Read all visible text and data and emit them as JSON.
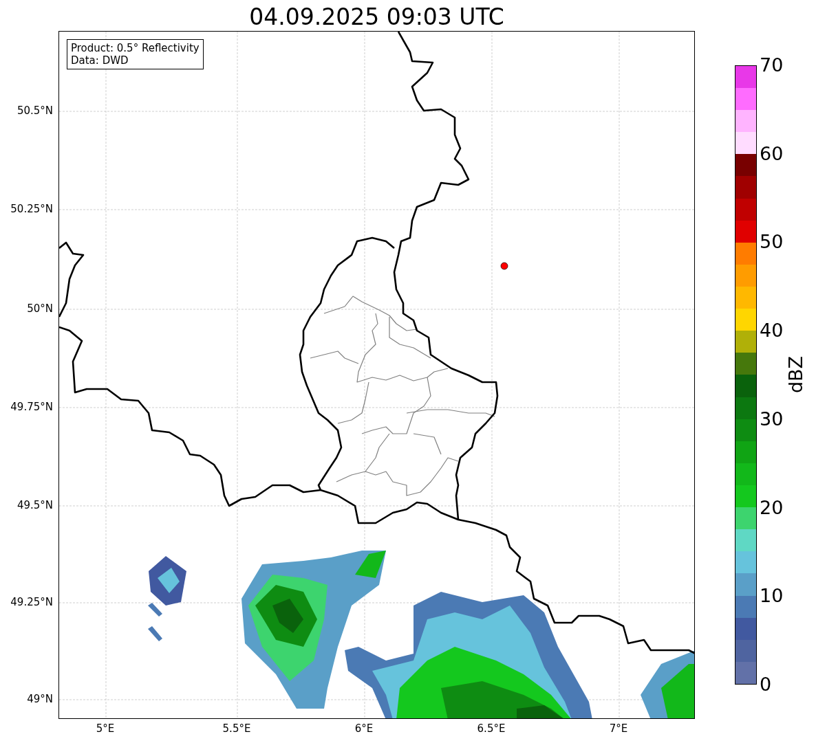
{
  "title": "04.09.2025 09:03 UTC",
  "annotation": [
    "Product: 0.5° Reflectivity",
    "Data: DWD"
  ],
  "y_ticks": [
    "50.5°N",
    "50.25°N",
    "50°N",
    "49.75°N",
    "49.5°N",
    "49.25°N",
    "49°N"
  ],
  "x_ticks": [
    "5°E",
    "5.5°E",
    "6°E",
    "6.5°E",
    "7°E"
  ],
  "colorbar": {
    "label": "dBZ",
    "ticks": [
      "70",
      "60",
      "50",
      "40",
      "30",
      "20",
      "10",
      "0"
    ],
    "bands": [
      {
        "color": "#6271a8"
      },
      {
        "color": "#4f64a0"
      },
      {
        "color": "#4159a0"
      },
      {
        "color": "#4b7ab4"
      },
      {
        "color": "#5a9fc8"
      },
      {
        "color": "#66c3dc"
      },
      {
        "color": "#5fd8c4"
      },
      {
        "color": "#3dd46e"
      },
      {
        "color": "#14c81e"
      },
      {
        "color": "#12b81a"
      },
      {
        "color": "#10a414"
      },
      {
        "color": "#0e8c12"
      },
      {
        "color": "#0c7810"
      },
      {
        "color": "#0a620c"
      },
      {
        "color": "#46780c"
      },
      {
        "color": "#b0b008"
      },
      {
        "color": "#ffd600"
      },
      {
        "color": "#ffb800"
      },
      {
        "color": "#ff9c00"
      },
      {
        "color": "#ff7c00"
      },
      {
        "color": "#e00000"
      },
      {
        "color": "#c00000"
      },
      {
        "color": "#a00000"
      },
      {
        "color": "#780000"
      },
      {
        "color": "#ffdcff"
      },
      {
        "color": "#ffb4ff"
      },
      {
        "color": "#ff6cff"
      },
      {
        "color": "#e838e8"
      }
    ]
  }
}
